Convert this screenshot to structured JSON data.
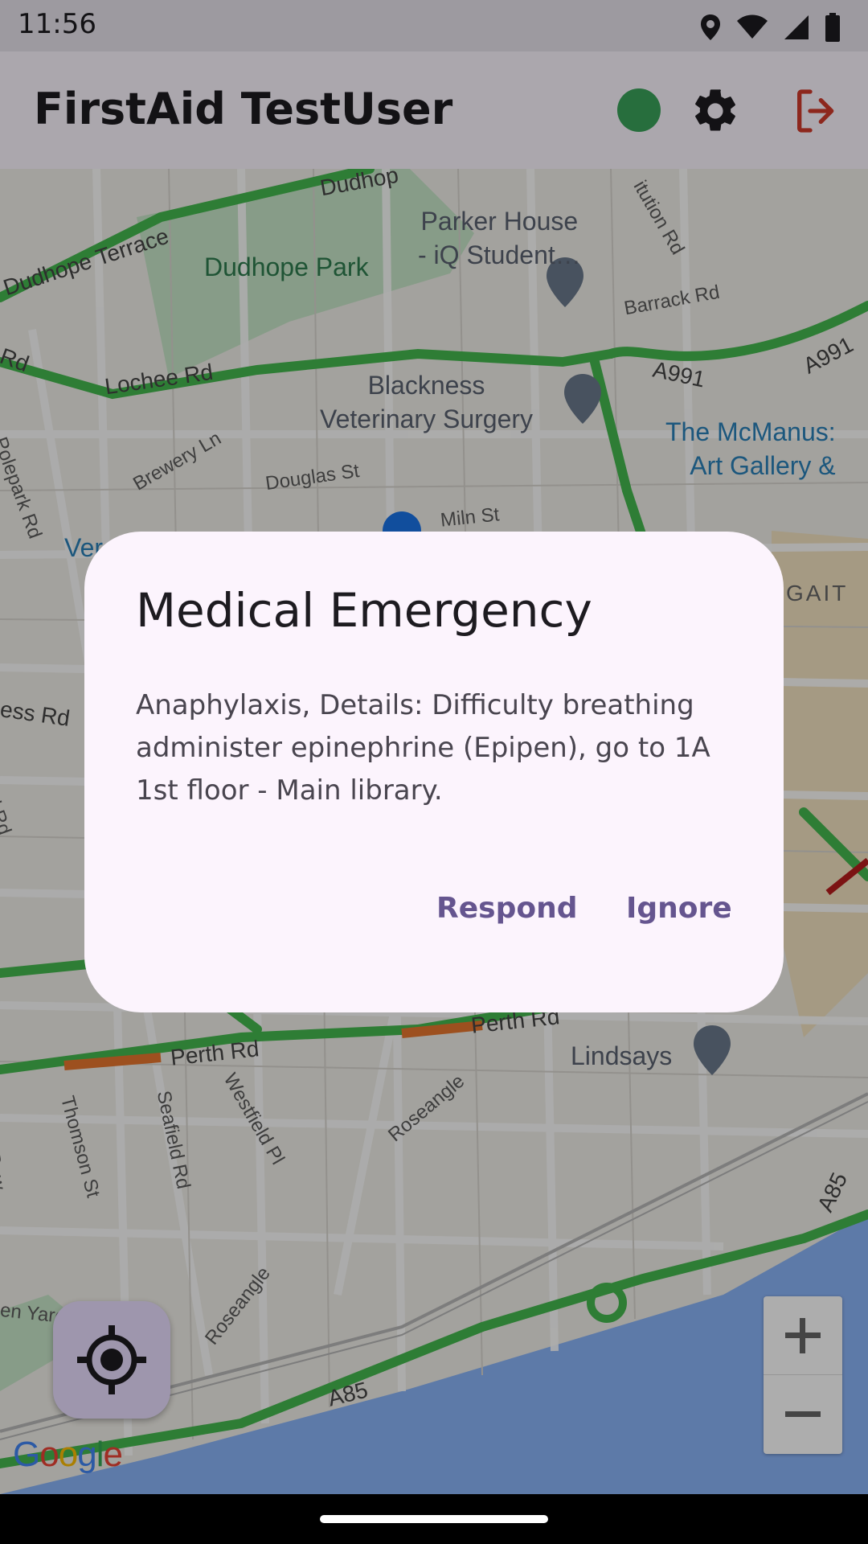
{
  "status_bar": {
    "time": "11:56",
    "icons": [
      "location-icon",
      "wifi-icon",
      "signal-icon",
      "battery-icon"
    ]
  },
  "app_bar": {
    "title": "FirstAid TestUser",
    "status_dot_color": "#3aa25a",
    "settings_icon": "gear-icon",
    "logout_icon": "logout-icon",
    "logout_color": "#d03a2b"
  },
  "map": {
    "park_labels": [
      "Dudhope Park"
    ],
    "poi_labels": [
      "Parker House\n- iQ Student…",
      "Blackness\nVeterinary Surgery",
      "Lindsays"
    ],
    "blue_labels": [
      "The McManus:\nArt Gallery &"
    ],
    "area_labels": [
      "GAIT"
    ],
    "street_labels": [
      "Dudhope Terrace",
      "Dudhop",
      "Lochee Rd",
      "Rd",
      "Polepark Rd",
      "Brewery Ln",
      "Douglas St",
      "Miln St",
      "Barrack Rd",
      "itution Rd",
      "A991",
      "A991",
      "ess Rd",
      "ld Rd",
      "Perth Rd",
      "Perth Rd",
      "Thomson St",
      "Seafield Rd",
      "Westfield Pl",
      "Roseangle",
      "Roseangle",
      "A85",
      "A85",
      "en Yard",
      "n Row",
      "Ver"
    ],
    "zoom_in_label": "+",
    "zoom_out_label": "−",
    "google_logo": "Google"
  },
  "dialog": {
    "title": "Medical Emergency",
    "body": "Anaphylaxis,  Details: Difficulty breathing administer epinephrine (Epipen), go to 1A 1st floor - Main library.",
    "respond_label": "Respond",
    "ignore_label": "Ignore"
  }
}
